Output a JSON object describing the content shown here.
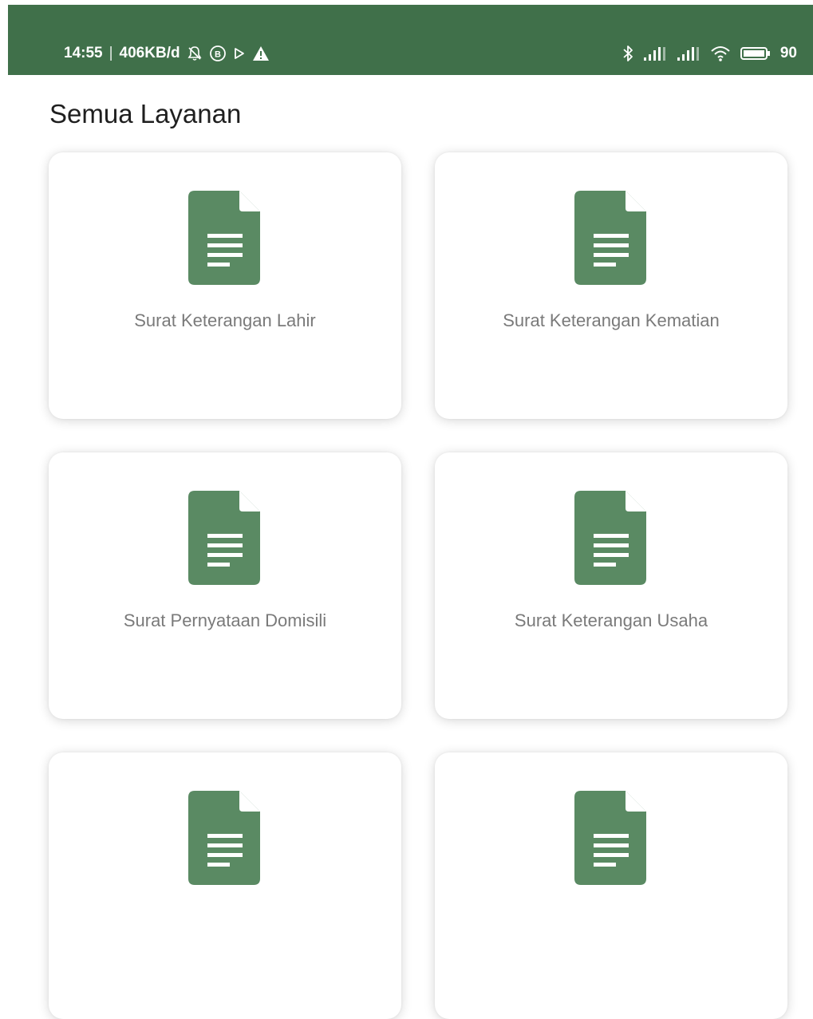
{
  "status_bar": {
    "time": "14:55",
    "separator": "|",
    "net_speed": "406KB/d",
    "battery": "90",
    "background_color": "#40704a",
    "left_icons": [
      "notification-off-icon",
      "b-circle-icon",
      "play-icon",
      "warning-icon"
    ],
    "right_icons": [
      "bluetooth-icon",
      "signal-icon",
      "signal-icon",
      "wifi-icon",
      "battery-icon"
    ]
  },
  "page": {
    "title": "Semua Layanan"
  },
  "services": [
    {
      "label": "Surat Keterangan Lahir",
      "icon": "document-icon"
    },
    {
      "label": "Surat Keterangan Kematian",
      "icon": "document-icon"
    },
    {
      "label": "Surat Pernyataan Domisili",
      "icon": "document-icon"
    },
    {
      "label": "Surat Keterangan Usaha",
      "icon": "document-icon"
    },
    {
      "label": "",
      "icon": "document-icon"
    },
    {
      "label": "",
      "icon": "document-icon"
    }
  ],
  "colors": {
    "icon_green": "#5a8a63",
    "label_gray": "#7a7a7a"
  }
}
